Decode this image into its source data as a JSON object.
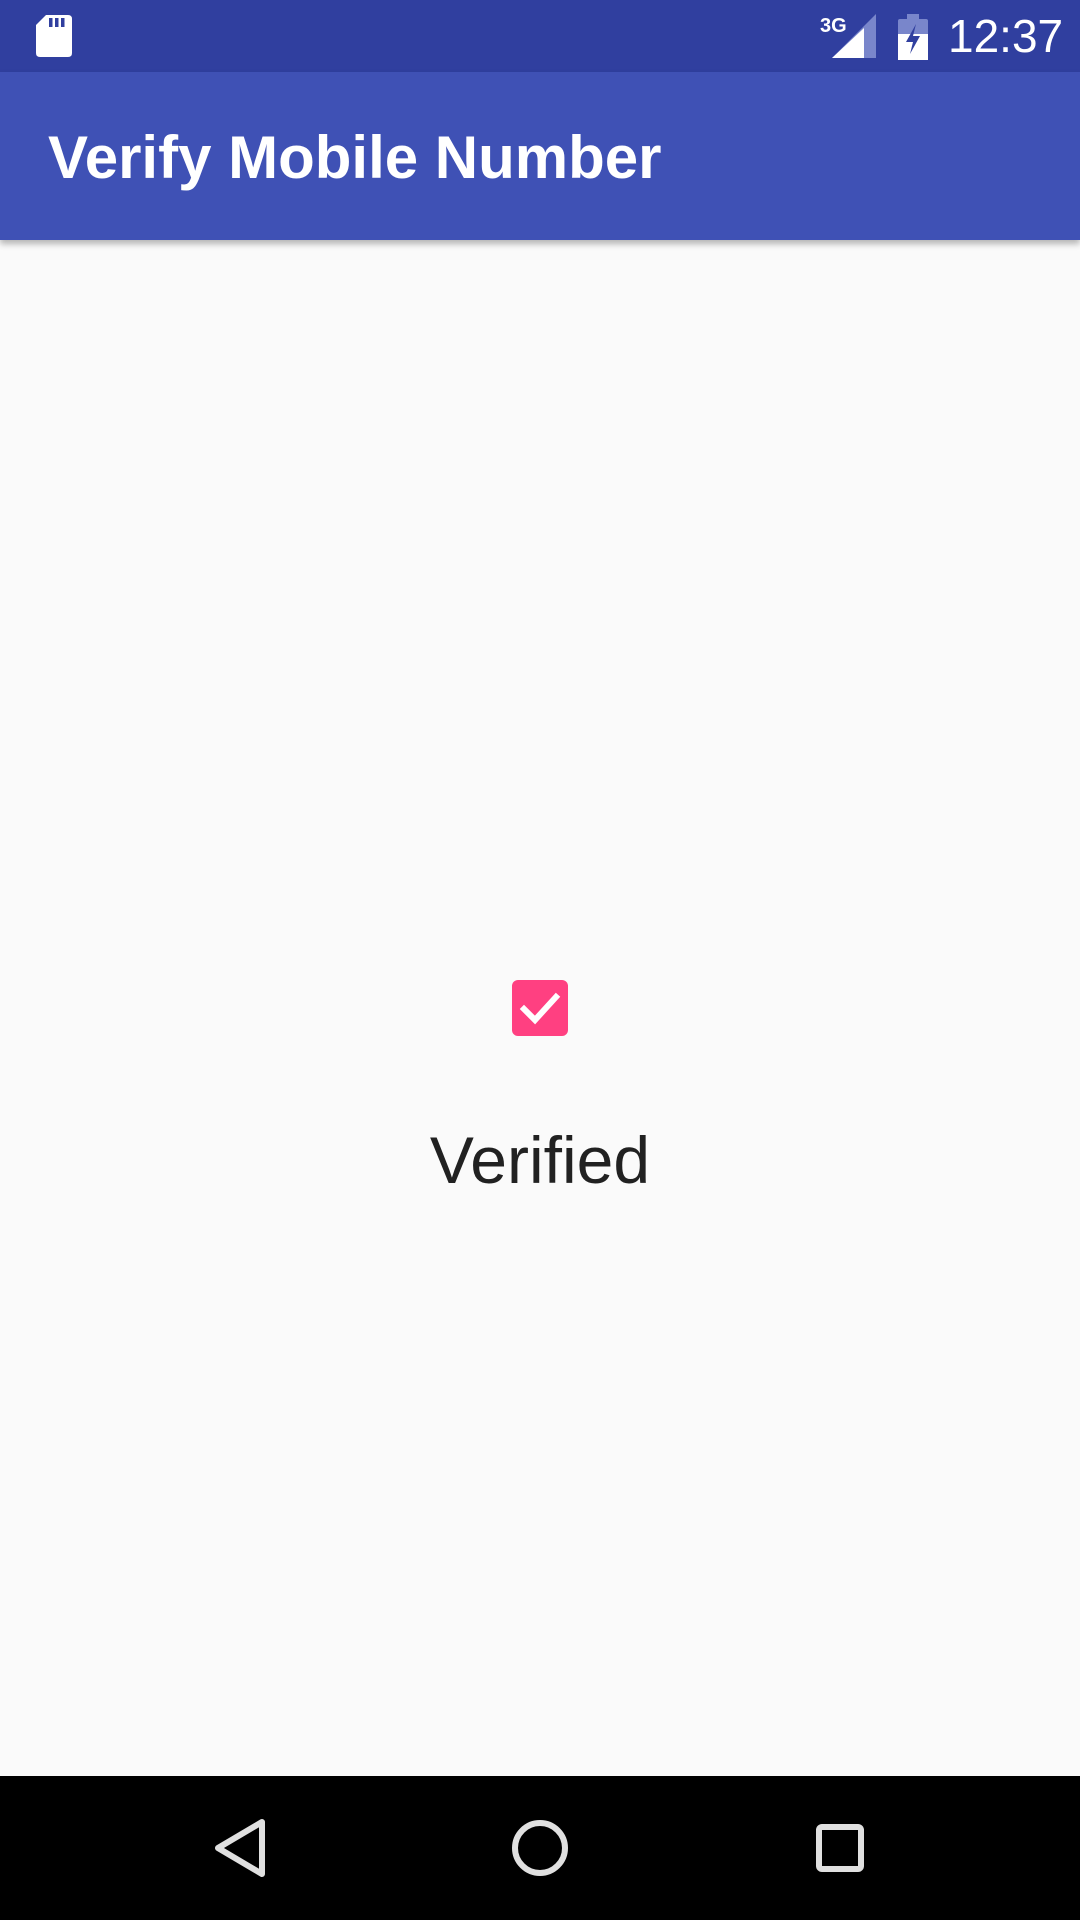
{
  "status_bar": {
    "network_type": "3G",
    "time": "12:37",
    "icons": [
      "sd-card-icon",
      "signal-icon",
      "battery-charging-icon"
    ]
  },
  "app_bar": {
    "title": "Verify Mobile Number"
  },
  "main": {
    "checkbox_checked": true,
    "status_text": "Verified"
  },
  "nav_bar": {
    "icons": [
      "back-icon",
      "home-icon",
      "recents-icon"
    ]
  },
  "colors": {
    "status_bar": "#303F9F",
    "app_bar": "#3F51B5",
    "accent": "#FF4081",
    "background": "#FAFAFA",
    "text_primary": "#212121",
    "nav_bar": "#000000"
  }
}
